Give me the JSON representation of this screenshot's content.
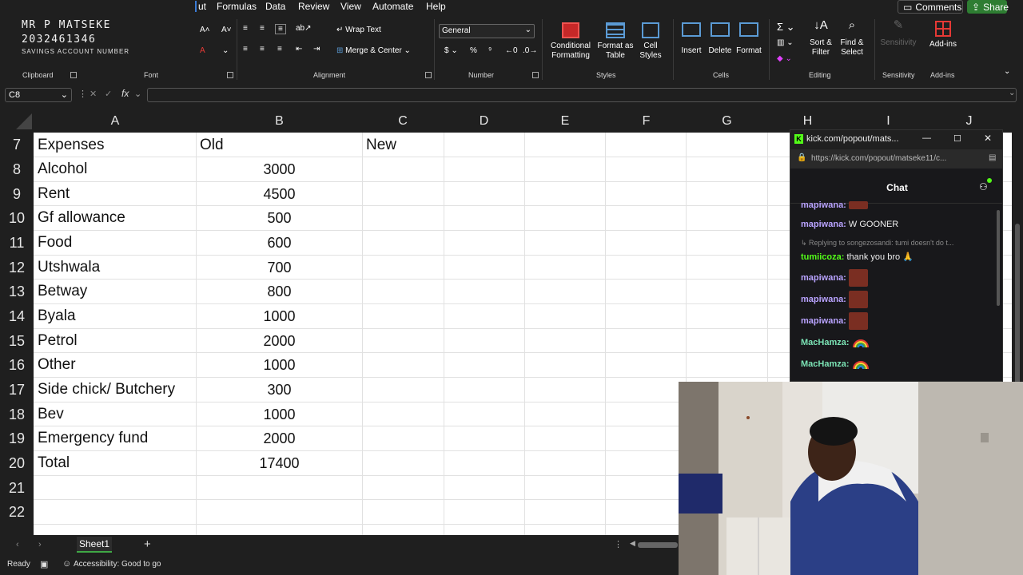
{
  "menu": {
    "partial": "ut",
    "formulas": "Formulas",
    "data": "Data",
    "review": "Review",
    "view": "View",
    "automate": "Automate",
    "help": "Help",
    "comments": "Comments",
    "share": "Share"
  },
  "account_overlay": {
    "name": "MR P MATSEKE",
    "number": "2032461346",
    "label": "SAVINGS ACCOUNT NUMBER"
  },
  "ribbon": {
    "groups": {
      "clipboard": "Clipboard",
      "font": "Font",
      "alignment": "Alignment",
      "number": "Number",
      "styles": "Styles",
      "cells": "Cells",
      "editing": "Editing",
      "sensitivity": "Sensitivity",
      "addins": "Add-ins"
    },
    "wrap_text": "Wrap Text",
    "merge_center": "Merge & Center",
    "number_format": "General",
    "conditional_formatting": [
      "Conditional",
      "Formatting"
    ],
    "format_as_table": [
      "Format as",
      "Table"
    ],
    "cell_styles": [
      "Cell",
      "Styles"
    ],
    "insert": "Insert",
    "delete": "Delete",
    "format": "Format",
    "sort_filter": [
      "Sort &",
      "Filter"
    ],
    "find_select": [
      "Find &",
      "Select"
    ],
    "sensitivity_btn": "Sensitivity",
    "addins_btn": "Add-ins"
  },
  "formula_bar": {
    "name_box": "C8",
    "fx": "fx",
    "value": ""
  },
  "columns": [
    "A",
    "B",
    "C",
    "D",
    "E",
    "F",
    "G",
    "H",
    "I",
    "J"
  ],
  "rows": [
    {
      "n": "7",
      "a": "Expenses",
      "b": "Old",
      "c": "New"
    },
    {
      "n": "8",
      "a": "Alcohol",
      "b": "3000"
    },
    {
      "n": "9",
      "a": "Rent",
      "b": "4500"
    },
    {
      "n": "10",
      "a": "Gf allowance",
      "b": "500"
    },
    {
      "n": "11",
      "a": "Food",
      "b": "600"
    },
    {
      "n": "12",
      "a": "Utshwala",
      "b": "700"
    },
    {
      "n": "13",
      "a": "Betway",
      "b": "800"
    },
    {
      "n": "14",
      "a": "Byala",
      "b": "1000"
    },
    {
      "n": "15",
      "a": "Petrol",
      "b": "2000"
    },
    {
      "n": "16",
      "a": "Other",
      "b": "1000"
    },
    {
      "n": "17",
      "a": "Side chick/ Butchery",
      "b": "300"
    },
    {
      "n": "18",
      "a": "Bev",
      "b": "1000"
    },
    {
      "n": "19",
      "a": "Emergency fund",
      "b": "2000"
    },
    {
      "n": "20",
      "a": "Total",
      "b": "17400"
    },
    {
      "n": "21",
      "a": "",
      "b": ""
    },
    {
      "n": "22",
      "a": "",
      "b": ""
    }
  ],
  "sheet_tab": "Sheet1",
  "status": {
    "ready": "Ready",
    "accessibility": "Accessibility: Good to go"
  },
  "chat_window": {
    "title": "kick.com/popout/mats...",
    "url": "https://kick.com/popout/matseke11/c...",
    "header": "Chat",
    "messages": [
      {
        "user": "mapiwana:",
        "text": "W GOONER"
      },
      {
        "reply": "Replying to songezosandi: tumi doesn't do t..."
      },
      {
        "user": "tumiicoza:",
        "text": "thank you bro 🙏"
      },
      {
        "user": "mapiwana:"
      },
      {
        "user": "mapiwana:"
      },
      {
        "user": "mapiwana:"
      },
      {
        "user": "MacHamza:"
      },
      {
        "user": "MacHamza:"
      }
    ],
    "colors": {
      "purple": "#b9a3ff",
      "green": "#53fc18",
      "teal": "#7be3b5"
    }
  }
}
